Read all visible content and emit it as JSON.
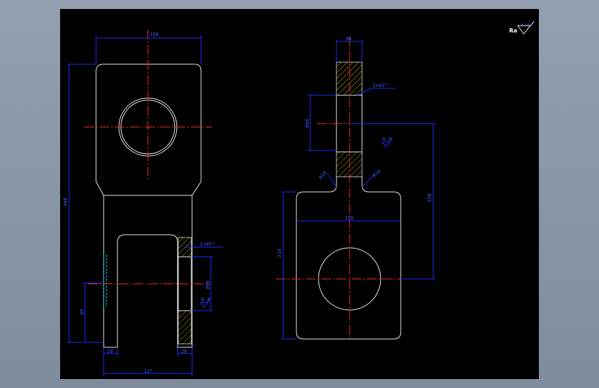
{
  "drawing": {
    "roughness": {
      "symbol": "Ra",
      "value": "6.3"
    },
    "front_view": {
      "dim_top_width": "150",
      "dim_total_height": "480",
      "dim_lower_height": "85",
      "dim_slot_left": "20",
      "dim_slot_right": "20",
      "dim_bottom_width": "127",
      "chamfer": "1×45°",
      "bore_dia": "Ø60",
      "bore_ra": "6.3"
    },
    "side_view": {
      "dim_shank_width": "30",
      "chamfer": "1×45°",
      "shank_dia": "Ø60",
      "shank_ra": "6.3",
      "fillet_left": "R10",
      "fillet_right": "R10",
      "dim_body_width": "150",
      "dim_body_height": "210",
      "dim_center_distance": "330"
    }
  }
}
